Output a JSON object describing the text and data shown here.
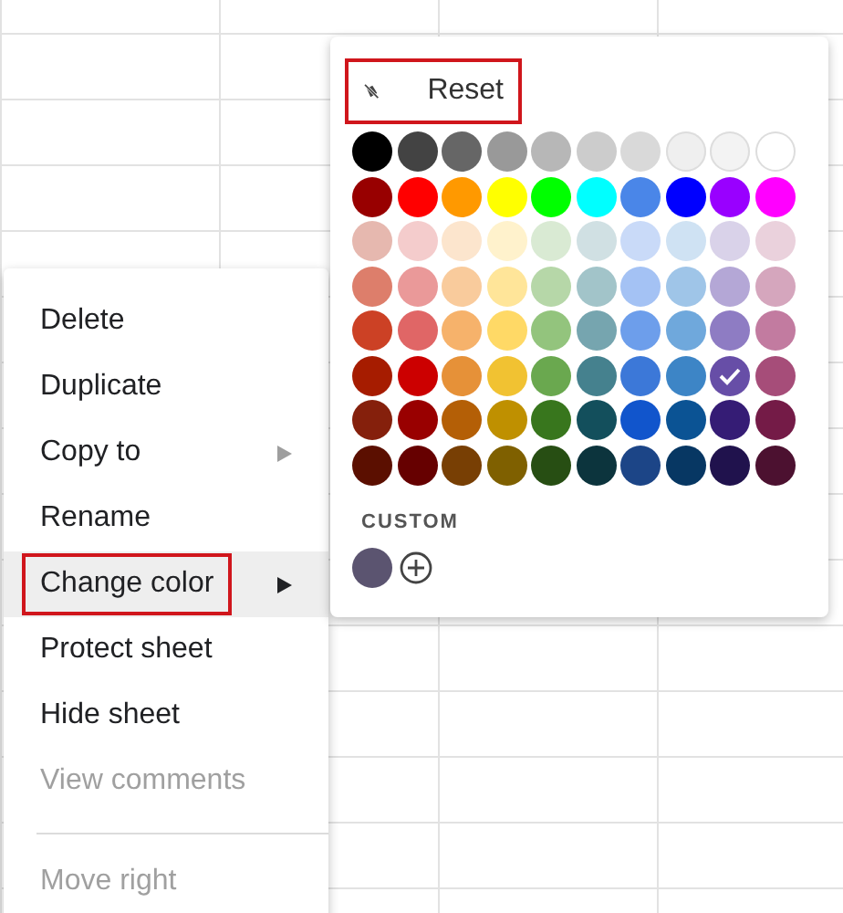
{
  "context_menu": {
    "items": [
      {
        "kind": "item",
        "label": "Delete",
        "submenu": false,
        "disabled": false,
        "selected": false,
        "annotated": false
      },
      {
        "kind": "item",
        "label": "Duplicate",
        "submenu": false,
        "disabled": false,
        "selected": false,
        "annotated": false
      },
      {
        "kind": "item",
        "label": "Copy to",
        "submenu": true,
        "disabled": false,
        "selected": false,
        "annotated": false
      },
      {
        "kind": "item",
        "label": "Rename",
        "submenu": false,
        "disabled": false,
        "selected": false,
        "annotated": false
      },
      {
        "kind": "item",
        "label": "Change color",
        "submenu": true,
        "disabled": false,
        "selected": true,
        "annotated": true
      },
      {
        "kind": "item",
        "label": "Protect sheet",
        "submenu": false,
        "disabled": false,
        "selected": false,
        "annotated": false
      },
      {
        "kind": "item",
        "label": "Hide sheet",
        "submenu": false,
        "disabled": false,
        "selected": false,
        "annotated": false
      },
      {
        "kind": "item",
        "label": "View comments",
        "submenu": false,
        "disabled": true,
        "selected": false,
        "annotated": false
      },
      {
        "kind": "separator"
      },
      {
        "kind": "item",
        "label": "Move right",
        "submenu": false,
        "disabled": true,
        "selected": false,
        "annotated": false
      }
    ]
  },
  "color_menu": {
    "reset": {
      "label": "Reset",
      "annotated": true
    },
    "palette": [
      [
        {
          "color": "#000000",
          "selected": false
        },
        {
          "color": "#434343",
          "selected": false
        },
        {
          "color": "#666666",
          "selected": false
        },
        {
          "color": "#999999",
          "selected": false
        },
        {
          "color": "#b7b7b7",
          "selected": false
        },
        {
          "color": "#cccccc",
          "selected": false
        },
        {
          "color": "#d9d9d9",
          "selected": false
        },
        {
          "color": "#efefef",
          "selected": false
        },
        {
          "color": "#f3f3f3",
          "selected": false
        },
        {
          "color": "#ffffff",
          "selected": false
        }
      ],
      [
        {
          "color": "#980000",
          "selected": false
        },
        {
          "color": "#ff0000",
          "selected": false
        },
        {
          "color": "#ff9900",
          "selected": false
        },
        {
          "color": "#ffff00",
          "selected": false
        },
        {
          "color": "#00ff00",
          "selected": false
        },
        {
          "color": "#00ffff",
          "selected": false
        },
        {
          "color": "#4a86e8",
          "selected": false
        },
        {
          "color": "#0000ff",
          "selected": false
        },
        {
          "color": "#9900ff",
          "selected": false
        },
        {
          "color": "#ff00ff",
          "selected": false
        }
      ],
      [
        {
          "color": "#e6b8af",
          "selected": false
        },
        {
          "color": "#f4cccc",
          "selected": false
        },
        {
          "color": "#fce5cd",
          "selected": false
        },
        {
          "color": "#fff2cc",
          "selected": false
        },
        {
          "color": "#d9ead3",
          "selected": false
        },
        {
          "color": "#d0e0e3",
          "selected": false
        },
        {
          "color": "#c9daf8",
          "selected": false
        },
        {
          "color": "#cfe2f3",
          "selected": false
        },
        {
          "color": "#d9d2e9",
          "selected": false
        },
        {
          "color": "#ead1dc",
          "selected": false
        }
      ],
      [
        {
          "color": "#dd7e6b",
          "selected": false
        },
        {
          "color": "#ea9999",
          "selected": false
        },
        {
          "color": "#f9cb9c",
          "selected": false
        },
        {
          "color": "#ffe599",
          "selected": false
        },
        {
          "color": "#b6d7a8",
          "selected": false
        },
        {
          "color": "#a2c4c9",
          "selected": false
        },
        {
          "color": "#a4c2f4",
          "selected": false
        },
        {
          "color": "#9fc5e8",
          "selected": false
        },
        {
          "color": "#b4a7d6",
          "selected": false
        },
        {
          "color": "#d5a6bd",
          "selected": false
        }
      ],
      [
        {
          "color": "#cc4125",
          "selected": false
        },
        {
          "color": "#e06666",
          "selected": false
        },
        {
          "color": "#f6b26b",
          "selected": false
        },
        {
          "color": "#ffd966",
          "selected": false
        },
        {
          "color": "#93c47d",
          "selected": false
        },
        {
          "color": "#76a5af",
          "selected": false
        },
        {
          "color": "#6d9eeb",
          "selected": false
        },
        {
          "color": "#6fa8dc",
          "selected": false
        },
        {
          "color": "#8e7cc3",
          "selected": false
        },
        {
          "color": "#c27ba0",
          "selected": false
        }
      ],
      [
        {
          "color": "#a61c00",
          "selected": false
        },
        {
          "color": "#cc0000",
          "selected": false
        },
        {
          "color": "#e69138",
          "selected": false
        },
        {
          "color": "#f1c232",
          "selected": false
        },
        {
          "color": "#6aa84f",
          "selected": false
        },
        {
          "color": "#45818e",
          "selected": false
        },
        {
          "color": "#3c78d8",
          "selected": false
        },
        {
          "color": "#3d85c6",
          "selected": false
        },
        {
          "color": "#674ea7",
          "selected": true
        },
        {
          "color": "#a64d79",
          "selected": false
        }
      ],
      [
        {
          "color": "#85200c",
          "selected": false
        },
        {
          "color": "#990000",
          "selected": false
        },
        {
          "color": "#b45f06",
          "selected": false
        },
        {
          "color": "#bf9000",
          "selected": false
        },
        {
          "color": "#38761d",
          "selected": false
        },
        {
          "color": "#134f5c",
          "selected": false
        },
        {
          "color": "#1155cc",
          "selected": false
        },
        {
          "color": "#0b5394",
          "selected": false
        },
        {
          "color": "#351c75",
          "selected": false
        },
        {
          "color": "#741b47",
          "selected": false
        }
      ],
      [
        {
          "color": "#5b0f00",
          "selected": false
        },
        {
          "color": "#660000",
          "selected": false
        },
        {
          "color": "#783f04",
          "selected": false
        },
        {
          "color": "#7f6000",
          "selected": false
        },
        {
          "color": "#274e13",
          "selected": false
        },
        {
          "color": "#0c343d",
          "selected": false
        },
        {
          "color": "#1c4587",
          "selected": false
        },
        {
          "color": "#073763",
          "selected": false
        },
        {
          "color": "#20124d",
          "selected": false
        },
        {
          "color": "#4c1130",
          "selected": false
        }
      ]
    ],
    "custom_label": "CUSTOM",
    "custom_colors": [
      {
        "color": "#5b5470"
      }
    ]
  }
}
